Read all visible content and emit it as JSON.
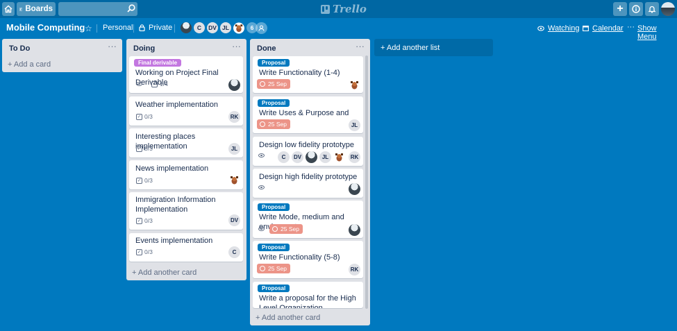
{
  "header": {
    "boards_label": "Boards",
    "logo_text": "Trello",
    "add_label": "+"
  },
  "board": {
    "title": "Mobile Computing",
    "team": "Personal",
    "visibility": "Private",
    "members": [
      {
        "initials": ""
      },
      {
        "initials": "C"
      },
      {
        "initials": "DV"
      },
      {
        "initials": "JL"
      },
      {
        "initials": ""
      }
    ],
    "member_count": "6",
    "watching": "Watching",
    "calendar": "Calendar",
    "show_menu": "Show Menu",
    "add_list": "Add another list"
  },
  "lists": {
    "todo": {
      "title": "To Do",
      "add_card": "Add a card"
    },
    "doing": {
      "title": "Doing",
      "add_card": "Add another card",
      "cards": [
        {
          "label": "Final derivable",
          "title": "Working on Project Final Derivable",
          "checklist": "1/4",
          "avatar": ""
        },
        {
          "title": "Weather implementation",
          "checklist": "0/3",
          "avatar": "RK"
        },
        {
          "title": "Interesting places implementation",
          "checklist": "0/3",
          "avatar": "JL"
        },
        {
          "title": "News implementation",
          "checklist": "0/3",
          "avatar": ""
        },
        {
          "title": "Immigration Information Implementation",
          "checklist": "0/3",
          "avatar": "DV"
        },
        {
          "title": "Events implementation",
          "checklist": "0/3",
          "avatar": "C"
        }
      ]
    },
    "done": {
      "title": "Done",
      "add_card": "Add another card",
      "cards": [
        {
          "label": "Proposal",
          "title": "Write Functionality (1-4)",
          "due": "25 Sep",
          "avatar": ""
        },
        {
          "label": "Proposal",
          "title": "Write Uses & Purpose and benefits",
          "due": "25 Sep",
          "avatar": "JL"
        },
        {
          "title": "Design low fidelity prototype",
          "avatars": [
            "C",
            "DV",
            "",
            "JL",
            "",
            "RK"
          ]
        },
        {
          "title": "Design high fidelity prototype",
          "avatar": ""
        },
        {
          "label": "Proposal",
          "title": "Write Mode, medium and enviroment",
          "due": "25 Sep",
          "avatar": ""
        },
        {
          "label": "Proposal",
          "title": "Write Functionality (5-8)",
          "due": "25 Sep",
          "avatar": "RK"
        },
        {
          "label": "Proposal",
          "title": "Write a proposal for the High Level Organization"
        }
      ]
    }
  },
  "colors": {
    "board_bg": "#0079bf",
    "header_bg": "#0067a3",
    "label_purple": "#c377e0",
    "label_blue": "#0079bf",
    "due_red": "#ec9488"
  },
  "icons": [
    "home-icon",
    "boards-icon",
    "search-icon",
    "trello-logo-icon",
    "plus-icon",
    "info-icon",
    "bell-icon",
    "star-icon",
    "lock-icon",
    "invite-icon",
    "eye-icon",
    "calendar-icon",
    "ellipsis-icon",
    "checklist-icon",
    "clock-icon"
  ]
}
